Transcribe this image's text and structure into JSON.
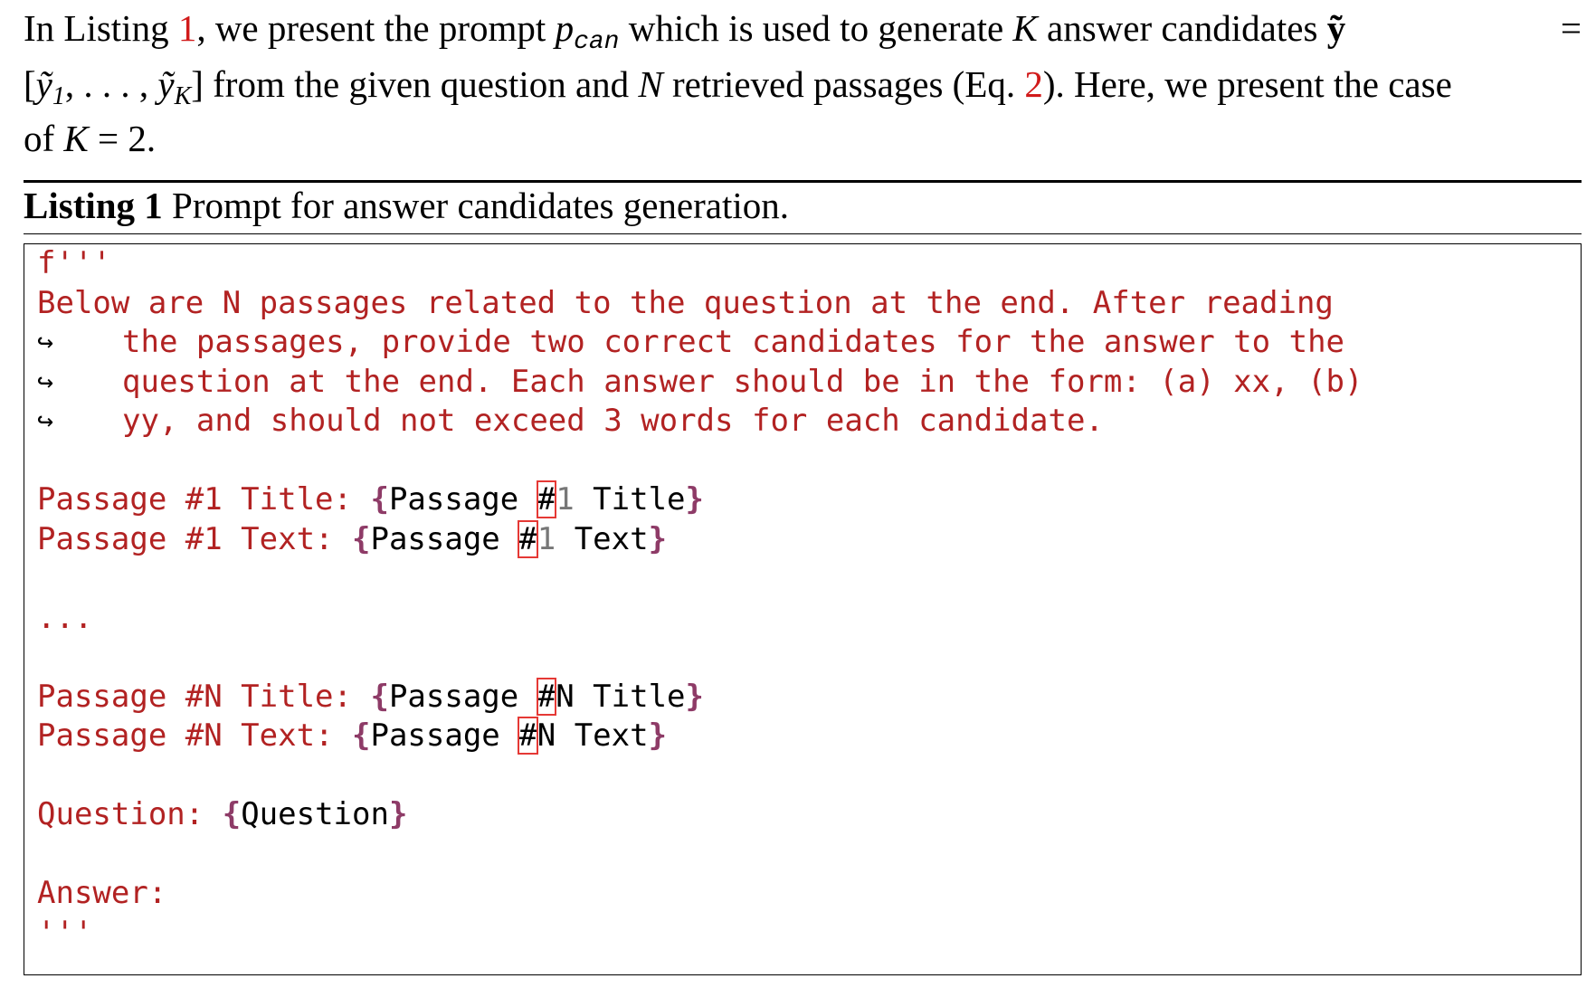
{
  "intro": {
    "line1": {
      "a": "In Listing ",
      "ref_listing": "1",
      "b": ", we present the prompt ",
      "p": "p",
      "p_sub": "can",
      "c": " which is used to generate ",
      "K": "K",
      "d": " answer candidates ",
      "y": "ỹ",
      "eq": "="
    },
    "line2": {
      "a": "[",
      "y1": "ỹ",
      "y1_sub": "1",
      "ellipsis": ", . . . , ",
      "yK": "ỹ",
      "yK_sub": "K",
      "b": "] from the given question and ",
      "N": "N",
      "c": " retrieved passages (Eq. ",
      "ref_eq": "2",
      "d": "). Here, we present the case"
    },
    "line3": {
      "a": "of ",
      "K": "K",
      "b": " = 2."
    }
  },
  "caption": {
    "label": "Listing 1",
    "text": " Prompt for answer candidates generation."
  },
  "code": {
    "open": "f'''",
    "instr1": "Below are N passages related to the question at the end. After reading",
    "instr2": "the passages, provide two correct candidates for the answer to the",
    "instr3": "question at the end. Each answer should be in the form: (a) xx, (b)",
    "instr4": "yy, and should not exceed 3 words for each candidate.",
    "arrow": "↪",
    "p1_title_label": "Passage #1 Title: ",
    "p1_text_label": "Passage #1 Text: ",
    "ph_passage": "Passage ",
    "hash": "#",
    "num1": "1",
    "numN": "N",
    "ph_title": " Title",
    "ph_text": " Text",
    "lbrace": "{",
    "rbrace": "}",
    "dots": "...",
    "pN_title_label": "Passage #N Title: ",
    "pN_text_label": "Passage #N Text: ",
    "question_label": "Question: ",
    "question_ph": "Question",
    "answer_label": "Answer:",
    "close": "'''"
  }
}
